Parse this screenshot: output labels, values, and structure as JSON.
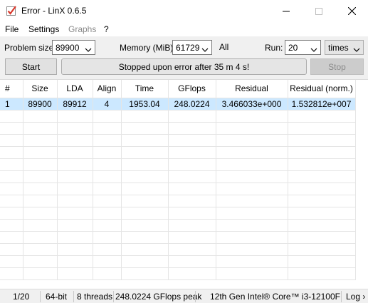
{
  "window": {
    "title": "Error - LinX 0.6.5"
  },
  "menu": {
    "items": [
      {
        "label": "File",
        "enabled": true
      },
      {
        "label": "Settings",
        "enabled": true
      },
      {
        "label": "Graphs",
        "enabled": false
      },
      {
        "label": "?",
        "enabled": true
      }
    ]
  },
  "controls": {
    "problem_size_label": "Problem size:",
    "problem_size_value": "89900",
    "memory_label": "Memory (MiB):",
    "memory_value": "61729",
    "all_label": "All",
    "run_label": "Run:",
    "run_value": "20",
    "run_unit": "times",
    "start_label": "Start",
    "status_message": "Stopped upon error after 35 m 4 s!",
    "stop_label": "Stop"
  },
  "table": {
    "columns": [
      "#",
      "Size",
      "LDA",
      "Align",
      "Time",
      "GFlops",
      "Residual",
      "Residual (norm.)"
    ],
    "rows": [
      [
        "1",
        "89900",
        "89912",
        "4",
        "1953.04",
        "248.0224",
        "3.466033e+000",
        "1.532812e+007"
      ]
    ]
  },
  "statusbar": {
    "progress": "1/20",
    "arch": "64-bit",
    "threads": "8 threads",
    "peak": "248.0224 GFlops peak",
    "cpu": "12th Gen Intel® Core™ i3-12100F",
    "log": "Log ›"
  },
  "colors": {
    "selected_row": "#cce8ff",
    "toolbar_bg": "#f0f0f0",
    "app_icon_red": "#d9382c"
  },
  "icons": {
    "app": "checkmark-icon",
    "minimize": "minimize-icon",
    "maximize": "maximize-icon",
    "close": "close-icon",
    "dropdown": "chevron-down-icon"
  }
}
